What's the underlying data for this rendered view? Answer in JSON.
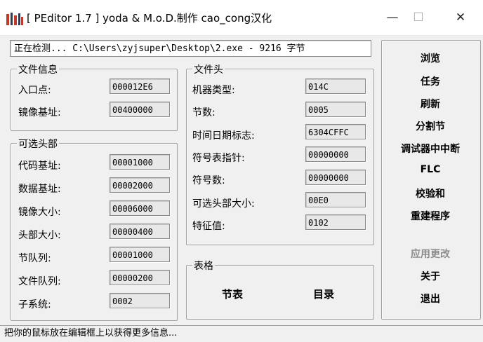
{
  "window": {
    "title": "[ PEditor 1.7 ] yoda & M.o.D.制作 cao_cong汉化",
    "minimize_glyph": "—",
    "maximize_glyph": "☐",
    "close_glyph": "✕"
  },
  "status_line": "正在检测... C:\\Users\\zyjsuper\\Desktop\\2.exe - 9216 字节",
  "file_info": {
    "label": "文件信息",
    "fields": [
      {
        "label": "入口点:",
        "value": "000012E6"
      },
      {
        "label": "镜像基址:",
        "value": "00400000"
      }
    ]
  },
  "optional_header": {
    "label": "可选头部",
    "fields": [
      {
        "label": "代码基址:",
        "value": "00001000"
      },
      {
        "label": "数据基址:",
        "value": "00002000"
      },
      {
        "label": "镜像大小:",
        "value": "00006000"
      },
      {
        "label": "头部大小:",
        "value": "00000400"
      },
      {
        "label": "节队列:",
        "value": "00001000"
      },
      {
        "label": "文件队列:",
        "value": "00000200"
      },
      {
        "label": "子系统:",
        "value": "0002"
      }
    ]
  },
  "file_header": {
    "label": "文件头",
    "fields": [
      {
        "label": "机器类型:",
        "value": "014C"
      },
      {
        "label": "节数:",
        "value": "0005"
      },
      {
        "label": "时间日期标志:",
        "value": "6304CFFC"
      },
      {
        "label": "符号表指针:",
        "value": "00000000"
      },
      {
        "label": "符号数:",
        "value": "00000000"
      },
      {
        "label": "可选头部大小:",
        "value": "00E0"
      },
      {
        "label": "特征值:",
        "value": "0102"
      }
    ]
  },
  "tables": {
    "label": "表格",
    "sections_button": "节表",
    "directory_button": "目录"
  },
  "side_buttons": {
    "browse": "浏览",
    "tasks": "任务",
    "refresh": "刷新",
    "split_sections": "分割节",
    "debugger_break": "调试器中中断",
    "flc": "FLC",
    "checksum": "校验和",
    "rebuild": "重建程序",
    "apply_changes": "应用更改",
    "about": "关于",
    "exit": "退出"
  },
  "hint_bar": "把你的鼠标放在编辑框上以获得更多信息..."
}
